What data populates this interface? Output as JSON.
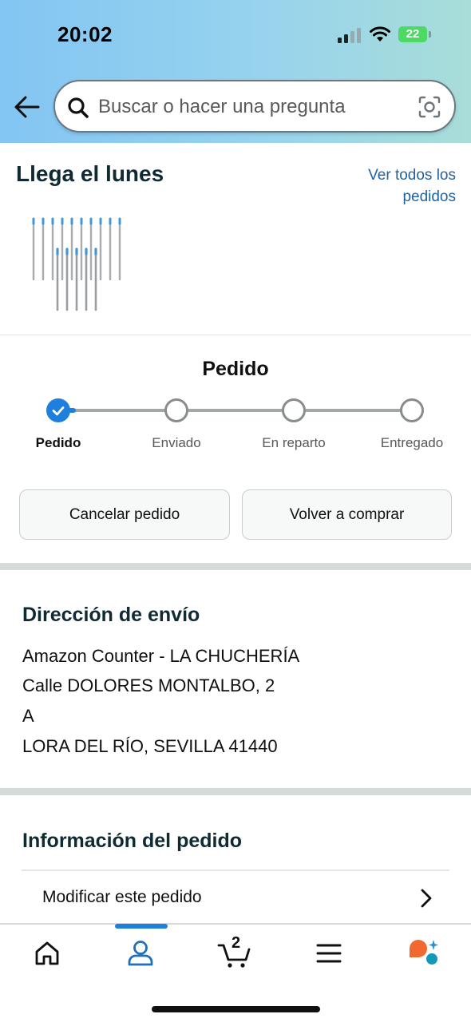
{
  "status_bar": {
    "time": "20:02",
    "battery": "22"
  },
  "search": {
    "placeholder": "Buscar o hacer una pregunta"
  },
  "delivery": {
    "title": "Llega el lunes",
    "view_all_link": "Ver todos los pedidos"
  },
  "tracker": {
    "title": "Pedido",
    "current_step": 0,
    "steps": [
      {
        "label": "Pedido"
      },
      {
        "label": "Enviado"
      },
      {
        "label": "En reparto"
      },
      {
        "label": "Entregado"
      }
    ]
  },
  "actions": {
    "cancel": "Cancelar pedido",
    "buy_again": "Volver a comprar"
  },
  "shipping": {
    "title": "Dirección de envío",
    "lines": [
      "Amazon Counter - LA CHUCHERÍA",
      "Calle DOLORES MONTALBO, 2",
      "A",
      "LORA DEL RÍO, SEVILLA 41440"
    ]
  },
  "order_info": {
    "title": "Información del pedido",
    "modify_label": "Modificar este pedido"
  },
  "tabbar": {
    "items": [
      {
        "icon": "home-icon"
      },
      {
        "icon": "account-icon",
        "active": true
      },
      {
        "icon": "cart-icon"
      },
      {
        "icon": "menu-icon"
      },
      {
        "icon": "assistant-icon"
      }
    ],
    "cart_count": "2"
  },
  "colors": {
    "accent": "#1f7fdc",
    "link": "#2162a1",
    "header_gradient_start": "#83c5f3",
    "header_gradient_end": "#a8ddd8"
  }
}
